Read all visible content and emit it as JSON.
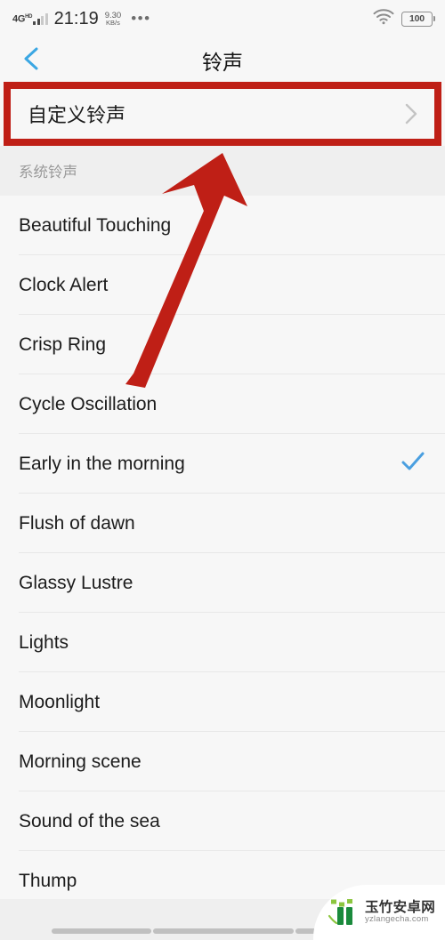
{
  "status_bar": {
    "network_type": "4G",
    "network_sup": "HD",
    "time": "21:19",
    "speed_value": "9.30",
    "speed_unit": "KB/s",
    "overflow_dots": "•••",
    "wifi_icon": "wifi-icon",
    "battery_level": "100"
  },
  "header": {
    "back_icon": "chevron-left-icon",
    "title": "铃声"
  },
  "custom_ringtone": {
    "label": "自定义铃声",
    "chevron_icon": "chevron-right-icon",
    "highlight_color": "#bf1f16"
  },
  "section": {
    "label": "系统铃声"
  },
  "ringtones": [
    {
      "name": "Beautiful Touching",
      "selected": false
    },
    {
      "name": "Clock Alert",
      "selected": false
    },
    {
      "name": "Crisp Ring",
      "selected": false
    },
    {
      "name": "Cycle Oscillation",
      "selected": false
    },
    {
      "name": "Early in the morning",
      "selected": true
    },
    {
      "name": "Flush of dawn",
      "selected": false
    },
    {
      "name": "Glassy Lustre",
      "selected": false
    },
    {
      "name": "Lights",
      "selected": false
    },
    {
      "name": "Moonlight",
      "selected": false
    },
    {
      "name": "Morning scene",
      "selected": false
    },
    {
      "name": "Sound of the sea",
      "selected": false
    },
    {
      "name": "Thump",
      "selected": false
    }
  ],
  "selected_ringtone": "Early in the morning",
  "check_icon": "check-icon",
  "check_color": "#4a9fe0",
  "annotation": {
    "arrow_icon": "arrow-up-right-icon",
    "arrow_color": "#bf1f16"
  },
  "navbar": {
    "segment_count": 3
  },
  "watermark": {
    "site_name": "玉竹安卓网",
    "url": "yzlangecha.com",
    "logo_icon": "bamboo-logo-icon",
    "logo_color": "#1a8a3c"
  }
}
